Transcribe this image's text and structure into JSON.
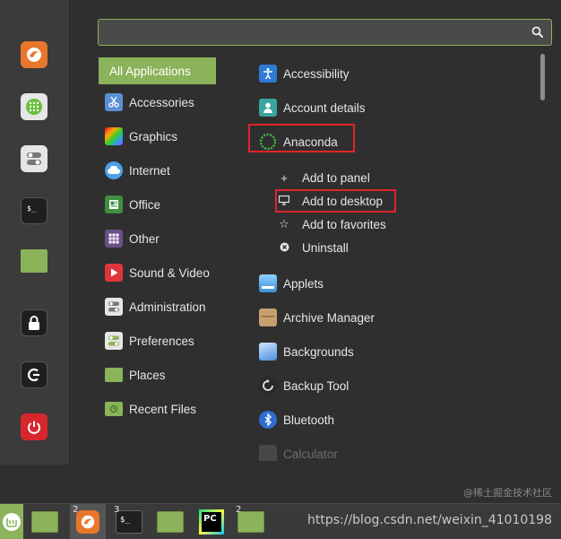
{
  "search": {
    "value": "",
    "placeholder": ""
  },
  "categories": [
    {
      "label": "All Applications",
      "icon": "none",
      "selected": true
    },
    {
      "label": "Accessories",
      "icon": "scissors-icon"
    },
    {
      "label": "Graphics",
      "icon": "graphics-icon"
    },
    {
      "label": "Internet",
      "icon": "cloud-icon"
    },
    {
      "label": "Office",
      "icon": "office-icon"
    },
    {
      "label": "Other",
      "icon": "grid-icon"
    },
    {
      "label": "Sound & Video",
      "icon": "play-icon"
    },
    {
      "label": "Administration",
      "icon": "toggle-icon"
    },
    {
      "label": "Preferences",
      "icon": "toggle-green-icon"
    },
    {
      "label": "Places",
      "icon": "folder-icon"
    },
    {
      "label": "Recent Files",
      "icon": "recent-folder-icon"
    }
  ],
  "apps": [
    {
      "label": "Accessibility",
      "icon": "accessibility-icon"
    },
    {
      "label": "Account details",
      "icon": "account-icon"
    },
    {
      "label": "Anaconda",
      "icon": "anaconda-icon"
    },
    {
      "label": "Applets",
      "icon": "applets-icon"
    },
    {
      "label": "Archive Manager",
      "icon": "archive-icon"
    },
    {
      "label": "Backgrounds",
      "icon": "backgrounds-icon"
    },
    {
      "label": "Backup Tool",
      "icon": "backup-icon"
    },
    {
      "label": "Bluetooth",
      "icon": "bluetooth-icon"
    },
    {
      "label": "Calculator",
      "icon": "calculator-icon"
    }
  ],
  "context_menu": [
    {
      "label": "Add to panel",
      "icon": "plus-icon"
    },
    {
      "label": "Add to desktop",
      "icon": "monitor-icon"
    },
    {
      "label": "Add to favorites",
      "icon": "star-icon"
    },
    {
      "label": "Uninstall",
      "icon": "uninstall-icon"
    }
  ],
  "taskbar": {
    "badges": {
      "firefox": "2",
      "terminal": "3",
      "last": "2"
    },
    "watermark": "https://blog.csdn.net/weixin_41010198",
    "watermark_top": "@稀土掘金技术社区"
  },
  "colors": {
    "accent": "#8ab35a",
    "highlight": "#e0242a",
    "background": "#2f2f2f"
  }
}
